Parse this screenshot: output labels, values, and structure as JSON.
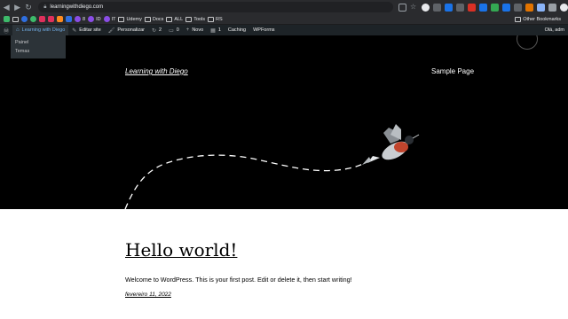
{
  "browser": {
    "url": "learningwithdiego.com",
    "bookmarks": [
      {
        "label": "",
        "icon": "favicon",
        "color": "#3dba6a"
      },
      {
        "label": "",
        "icon": "favicon",
        "color": "#e6612f"
      },
      {
        "label": "",
        "icon": "favicon",
        "color": "#2f6fe0"
      },
      {
        "label": "",
        "icon": "favicon",
        "color": "#e0305c"
      },
      {
        "label": "",
        "icon": "favicon",
        "color": "#ff8b1f"
      },
      {
        "label": "",
        "icon": "favicon",
        "color": "#8a4de6"
      },
      {
        "label": "8",
        "icon": "favicon",
        "color": "#8a4de6"
      },
      {
        "label": "ID",
        "icon": "favicon",
        "color": "#8a4de6"
      },
      {
        "label": "IT",
        "icon": "favicon",
        "color": "#8a4de6"
      },
      {
        "label": "Udemy",
        "icon": "folder",
        "color": ""
      },
      {
        "label": "Docs",
        "icon": "folder",
        "color": ""
      },
      {
        "label": "ALL",
        "icon": "folder",
        "color": ""
      },
      {
        "label": "Tools",
        "icon": "folder",
        "color": ""
      },
      {
        "label": "RS",
        "icon": "folder",
        "color": ""
      }
    ],
    "other_bookmarks": "Other Bookmarks"
  },
  "adminbar": {
    "site_name": "Learning with Diego",
    "edit_site": "Editar site",
    "customize": "Personalizar",
    "updates_count": "2",
    "comments_count": "0",
    "new_label": "Novo",
    "forms_count": "1",
    "caching": "Caching",
    "wpforms": "WPForms",
    "greeting": "Olá, adm"
  },
  "dropdown": {
    "items": [
      "Painel",
      "Temas"
    ]
  },
  "site": {
    "title": "Learning with Diego",
    "nav_item": "Sample Page"
  },
  "post": {
    "title": "Hello world!",
    "body": "Welcome to WordPress. This is your first post. Edit or delete it, then start writing!",
    "date": "fevereiro 11, 2022"
  }
}
